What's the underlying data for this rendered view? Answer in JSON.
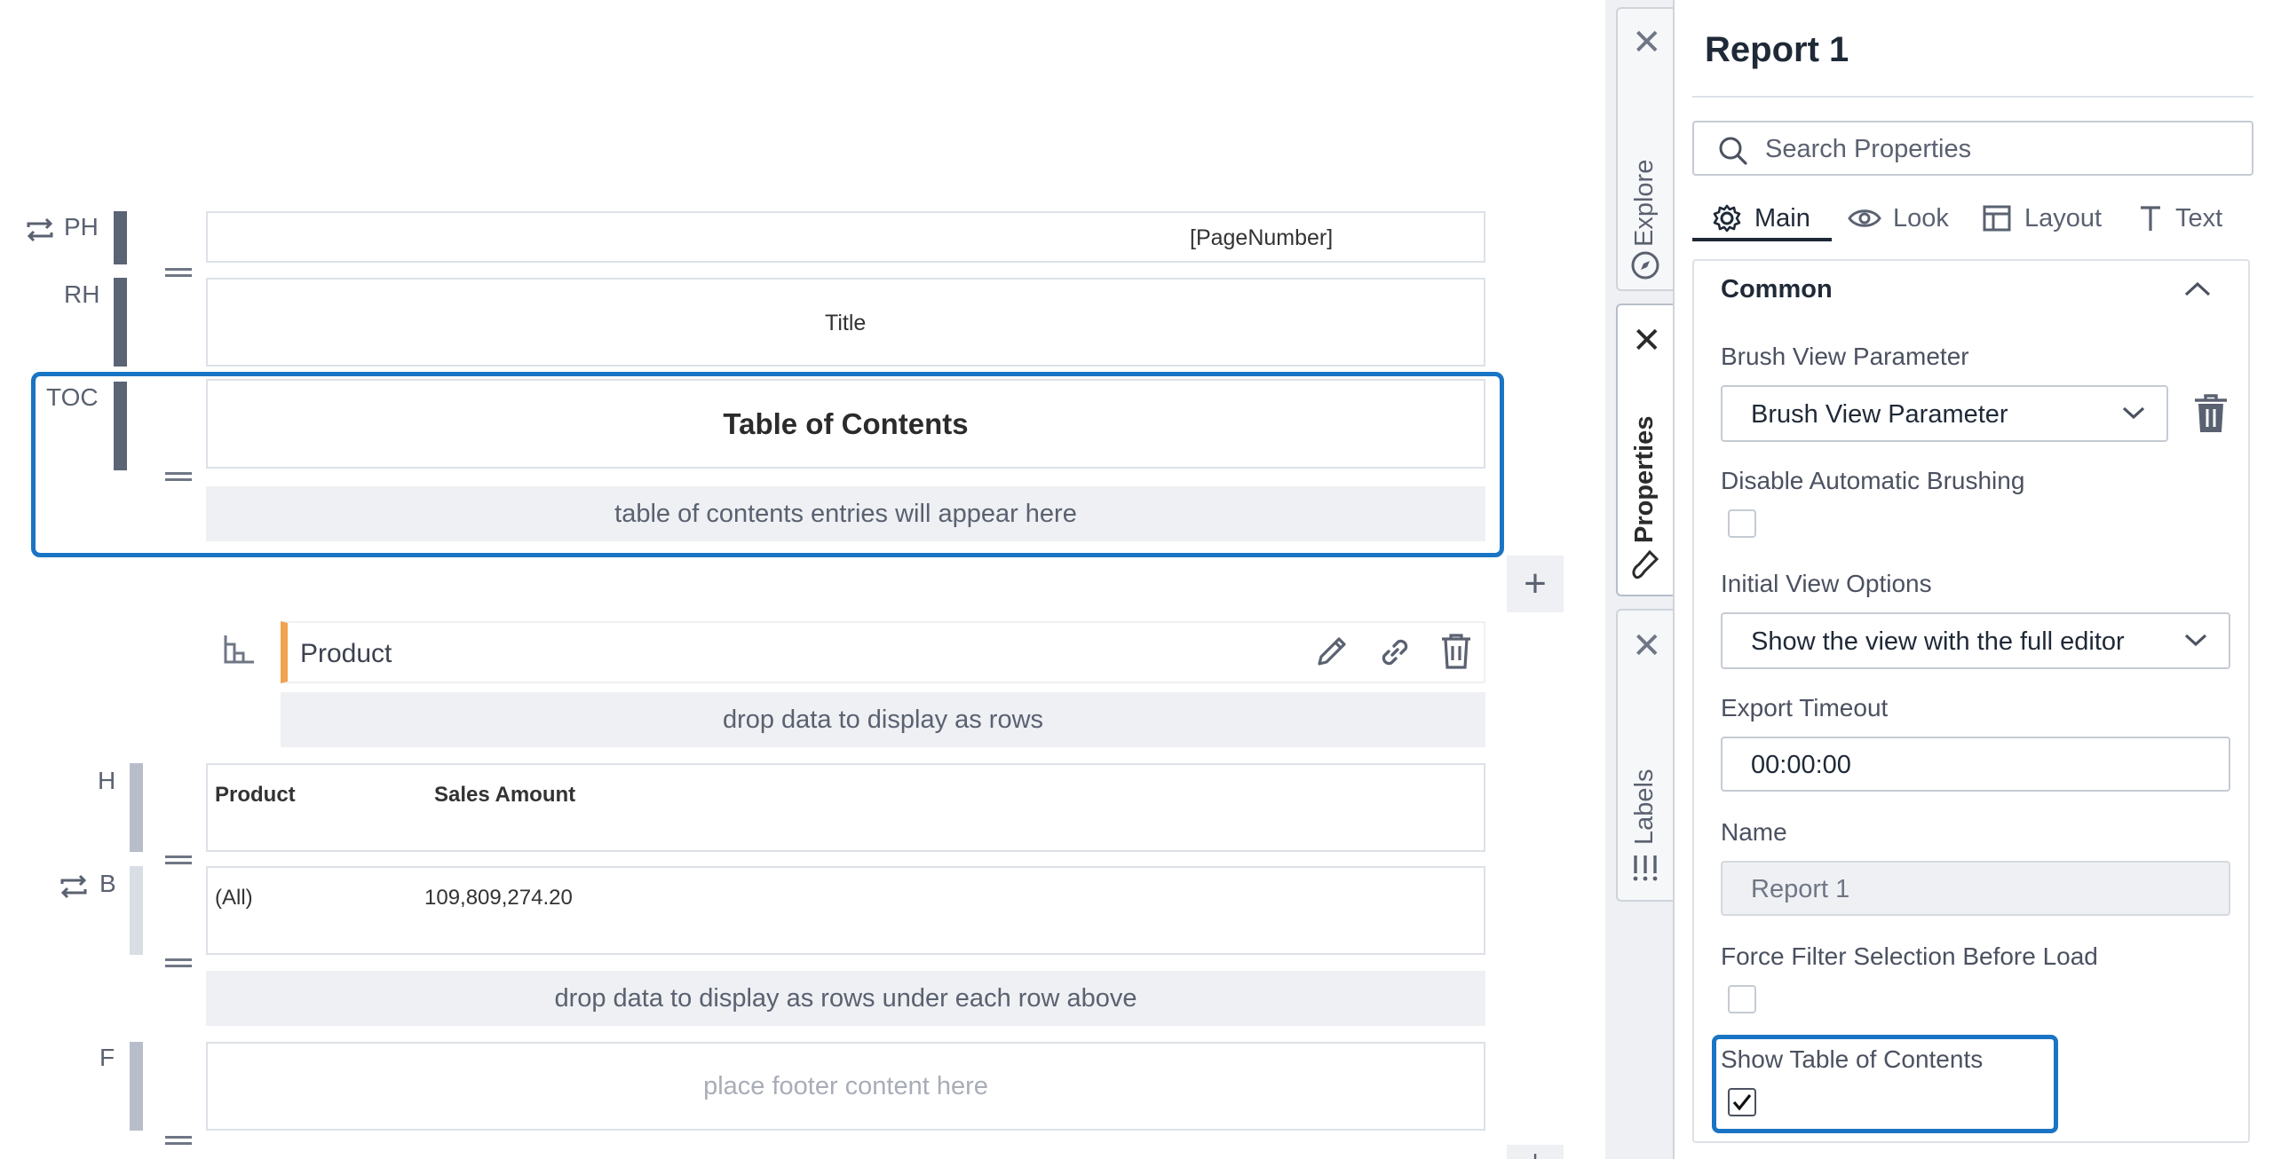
{
  "bands": {
    "page_header": {
      "label": "PH",
      "content": "[PageNumber]"
    },
    "report_header": {
      "label": "RH",
      "content": "Title"
    },
    "toc": {
      "label": "TOC",
      "title": "Table of Contents",
      "entries_hint": "table of contents entries will appear here"
    },
    "group": {
      "name": "Product",
      "drop_hint": "drop data to display as rows"
    },
    "header": {
      "label": "H",
      "col1": "Product",
      "col2": "Sales Amount"
    },
    "body": {
      "label": "B",
      "col1": "(All)",
      "col2": "109,809,274.20",
      "drop_hint": "drop data to display as rows under each row above"
    },
    "footer": {
      "label": "F",
      "hint": "place footer content here"
    }
  },
  "side_tabs": {
    "explore": "Explore",
    "properties": "Properties",
    "labels": "Labels"
  },
  "panel": {
    "title": "Report 1",
    "search_placeholder": "Search Properties",
    "tabs": [
      "Main",
      "Look",
      "Layout",
      "Text"
    ],
    "section": "Common",
    "brush_label": "Brush View Parameter",
    "brush_value": "Brush View Parameter",
    "disable_brushing_label": "Disable Automatic Brushing",
    "disable_brushing_checked": false,
    "initial_view_label": "Initial View Options",
    "initial_view_value": "Show the view with the full editor",
    "export_timeout_label": "Export Timeout",
    "export_timeout_value": "00:00:00",
    "name_label": "Name",
    "name_value": "Report 1",
    "force_filter_label": "Force Filter Selection Before Load",
    "force_filter_checked": false,
    "show_toc_label": "Show Table of Contents",
    "show_toc_checked": true
  },
  "colors": {
    "accent": "#1a74c4",
    "group_marker": "#f0a24f",
    "band_bar": "#5b6475"
  }
}
